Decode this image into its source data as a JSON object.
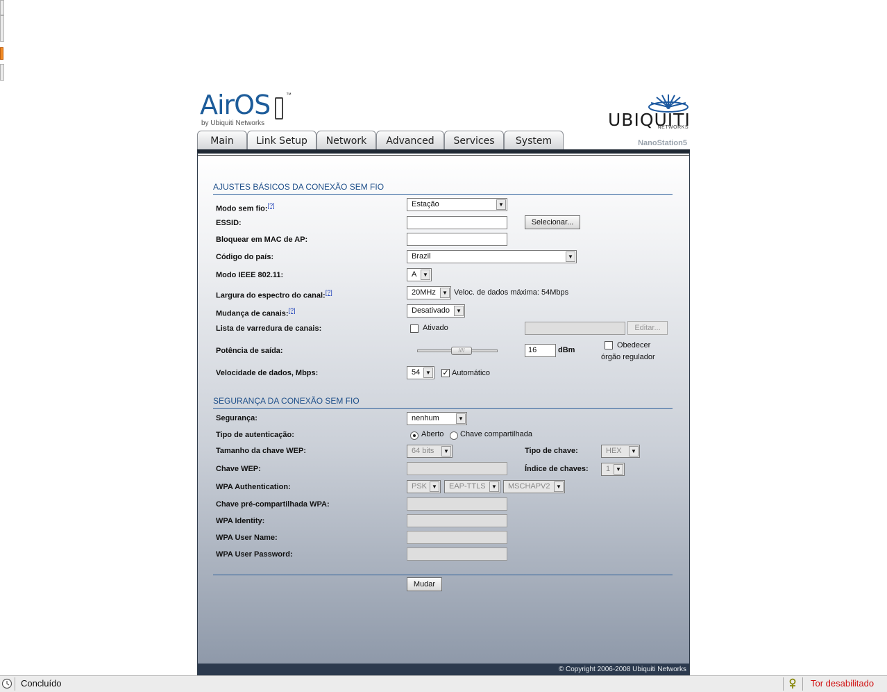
{
  "branding": {
    "logo_main": "AirOS",
    "logo_byline": "by Ubiquiti Networks",
    "logo_tm": "™",
    "vendor": "UBIQUITI",
    "vendor_sub": "NETWORKS",
    "device_name": "NanoStation5"
  },
  "tabs": [
    {
      "label": "Main"
    },
    {
      "label": "Link Setup"
    },
    {
      "label": "Network"
    },
    {
      "label": "Advanced"
    },
    {
      "label": "Services"
    },
    {
      "label": "System"
    }
  ],
  "active_tab": "Link Setup",
  "basic": {
    "title": "AJUSTES BÁSICOS DA CONEXÃO SEM FIO",
    "help": "[?]",
    "wireless_mode_label": "Modo sem fio:",
    "wireless_mode_value": "Estação",
    "essid_label": "ESSID:",
    "essid_value": "",
    "select_button": "Selecionar...",
    "lock_mac_label": "Bloquear em MAC de AP:",
    "lock_mac_value": "",
    "country_label": "Código do país:",
    "country_value": "Brazil",
    "ieee_label": "Modo IEEE 802.11:",
    "ieee_value": "A",
    "width_label": "Largura do espectro do canal:",
    "width_value": "20MHz",
    "max_rate_text": "Veloc. de dados máxima: 54Mbps",
    "shifting_label": "Mudança de canais:",
    "shifting_value": "Desativado",
    "scan_label": "Lista de varredura de canais:",
    "scan_enabled_label": "Ativado",
    "scan_enabled": false,
    "scan_list_value": "",
    "edit_button": "Editar...",
    "power_label": "Potência de saída:",
    "power_value": "16",
    "power_unit": "dBm",
    "power_slider_fraction": 0.57,
    "obey_line1": "Obedecer",
    "obey_line2": "órgão regulador",
    "obey_checked": false,
    "rate_label": "Velocidade de dados, Mbps:",
    "rate_value": "54",
    "auto_label": "Automático",
    "auto_checked": true
  },
  "security": {
    "title": "SEGURANÇA DA CONEXÃO SEM FIO",
    "security_label": "Segurança:",
    "security_value": "nenhum",
    "auth_label": "Tipo de autenticação:",
    "auth_open_label": "Aberto",
    "auth_shared_label": "Chave compartilhada",
    "auth_selected": "Aberto",
    "wep_len_label": "Tamanho da chave WEP:",
    "wep_len_value": "64 bits",
    "key_type_label": "Tipo de chave:",
    "key_type_value": "HEX",
    "wep_key_label": "Chave WEP:",
    "wep_key_value": "",
    "key_index_label": "Índice de chaves:",
    "key_index_value": "1",
    "wpa_auth_label": "WPA Authentication:",
    "wpa_auth_values": [
      "PSK",
      "EAP-TTLS",
      "MSCHAPV2"
    ],
    "wpa_psk_label": "Chave pré-compartilhada WPA:",
    "wpa_identity_label": "WPA Identity:",
    "wpa_user_label": "WPA User Name:",
    "wpa_pass_label": "WPA User Password:"
  },
  "change_button": "Mudar",
  "footer_text": "© Copyright 2006-2008 Ubiquiti Networks",
  "statusbar": {
    "status": "Concluído",
    "tor": "Tor desabilitado"
  }
}
